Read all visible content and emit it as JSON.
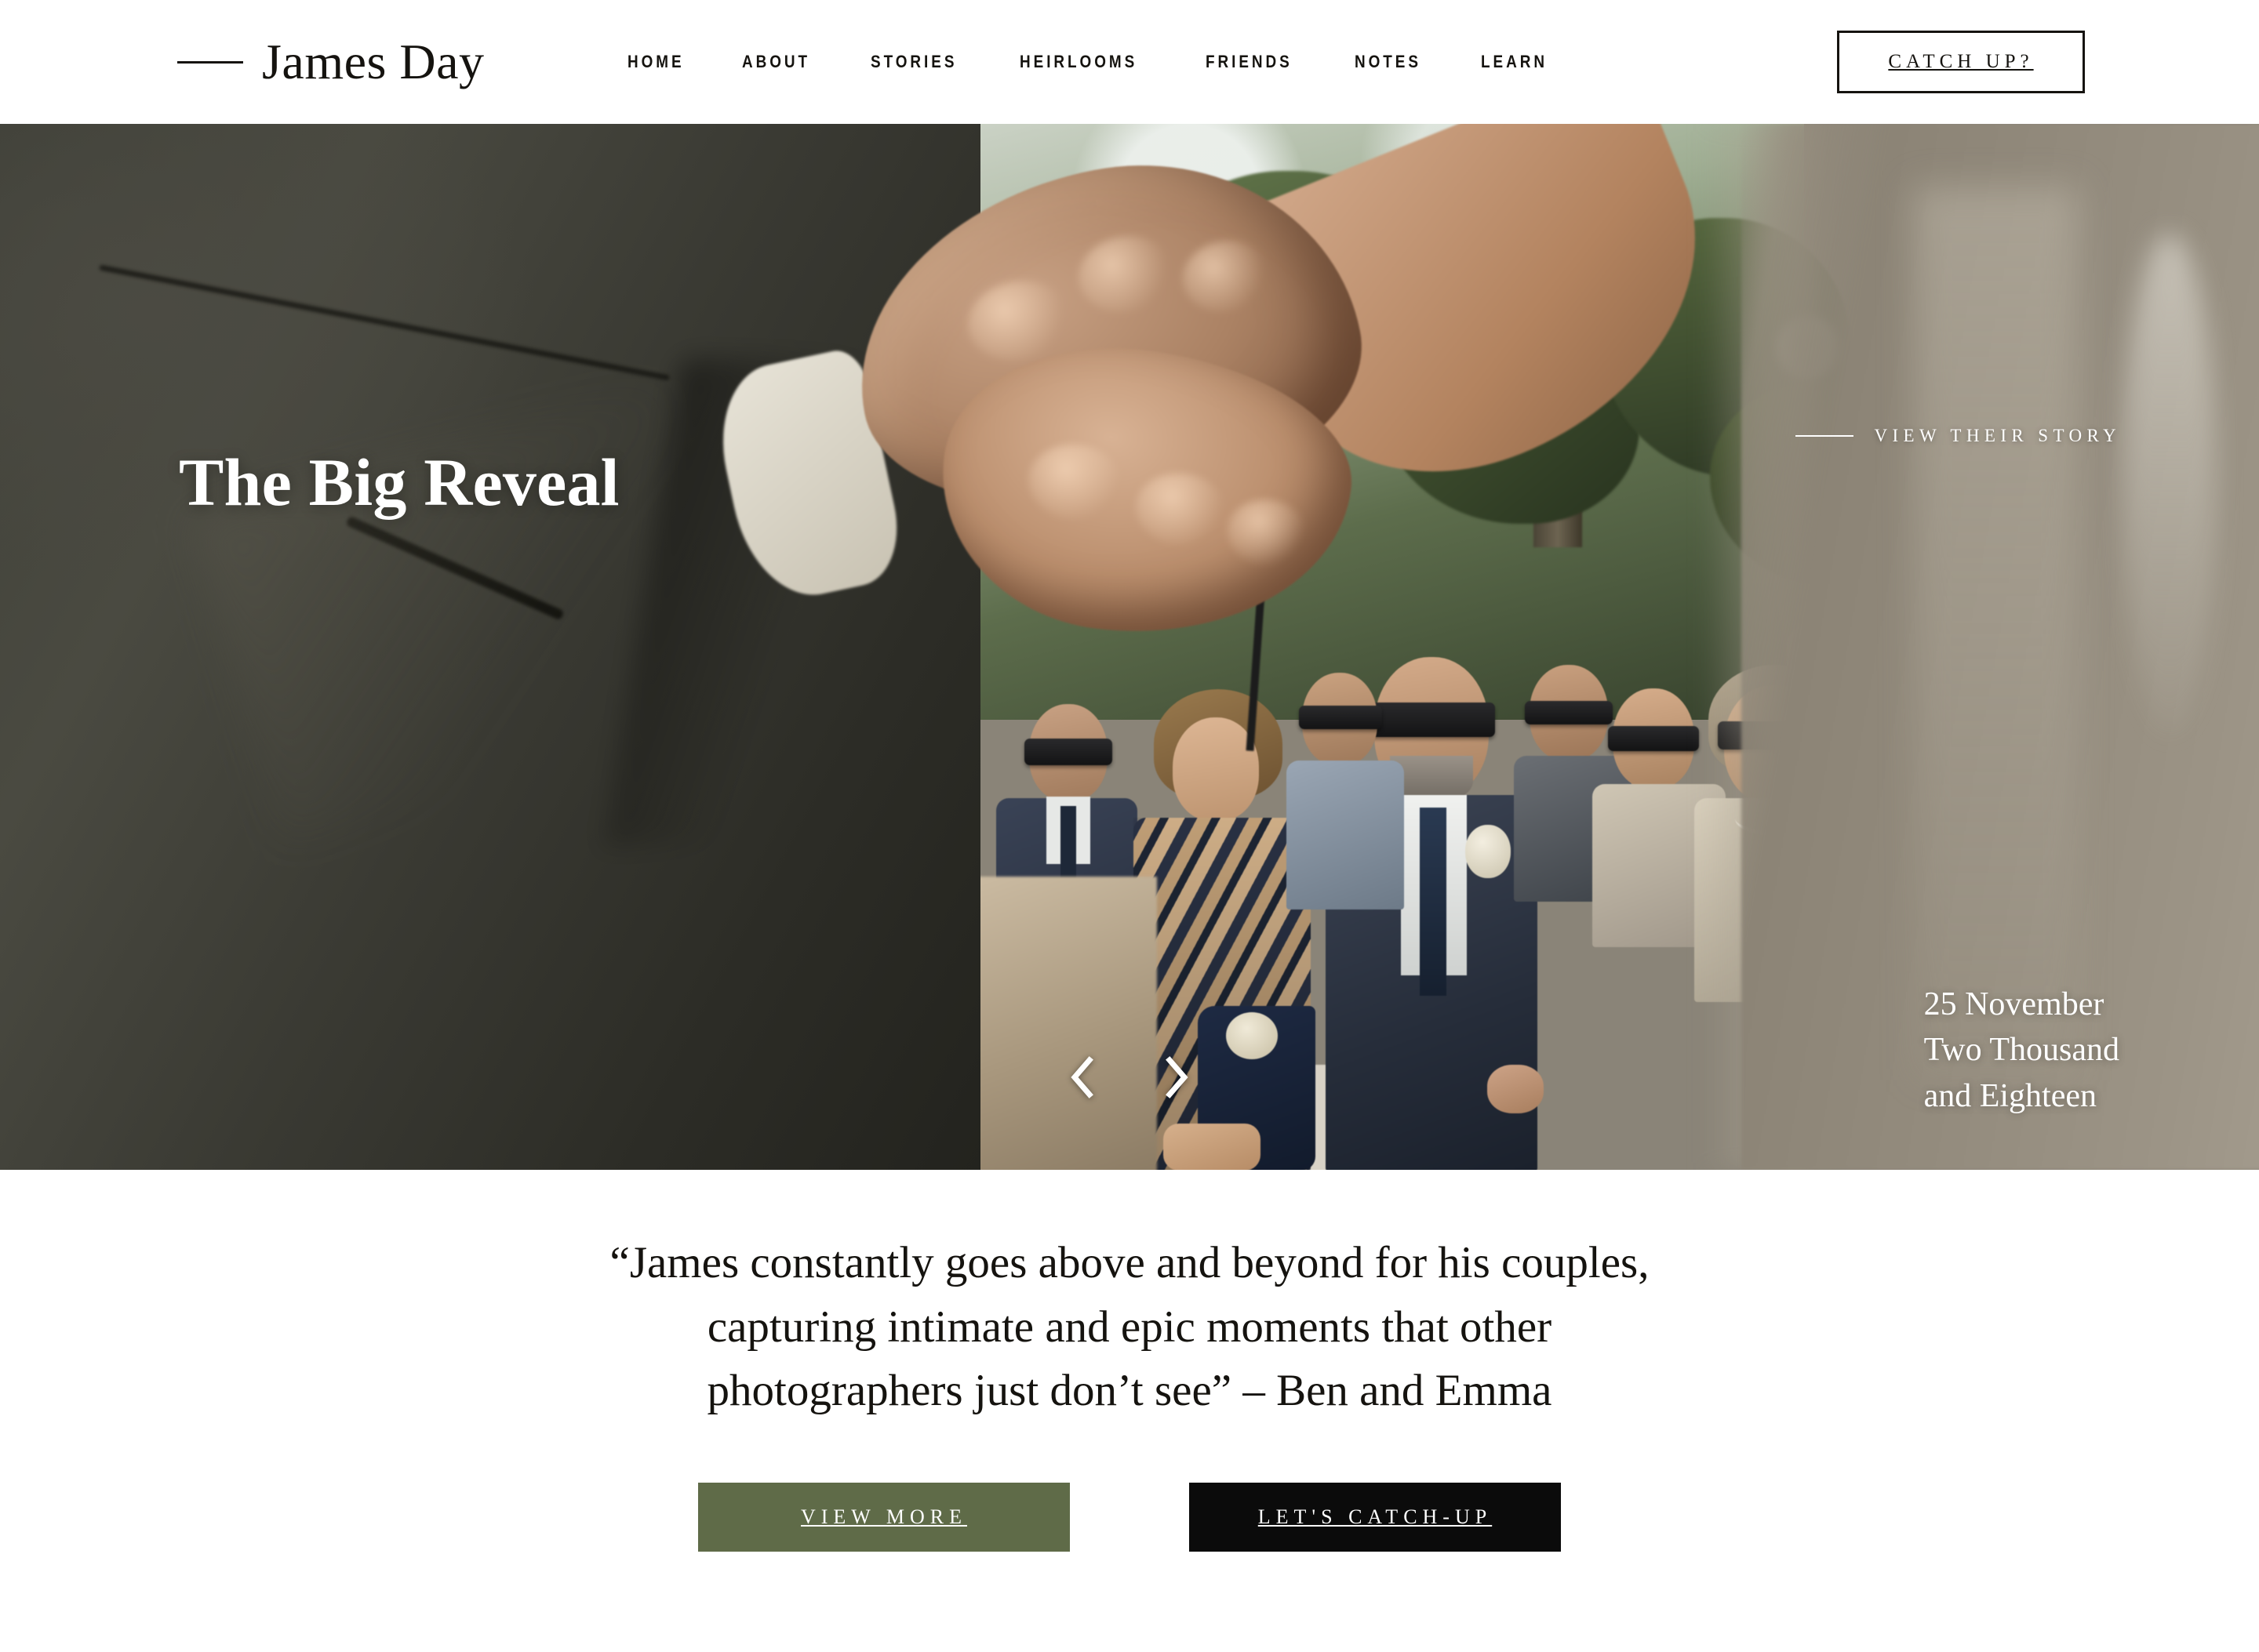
{
  "header": {
    "logo": {
      "text": "James Day",
      "rule_icon": "horizontal-rule-icon"
    },
    "nav": [
      {
        "label": "HOME"
      },
      {
        "label": "ABOUT"
      },
      {
        "label": "STORIES"
      },
      {
        "label": "HEIRLOOMS"
      },
      {
        "label": "FRIENDS"
      },
      {
        "label": "NOTES"
      },
      {
        "label": "LEARN"
      }
    ],
    "cta": {
      "label": "CATCH UP?"
    }
  },
  "hero": {
    "title": "The Big Reveal",
    "view_story": {
      "label": "VIEW THEIR STORY",
      "rule_icon": "horizontal-rule-icon"
    },
    "date": "25 November\nTwo Thousand\nand Eighteen",
    "date_lines": [
      "25 November",
      "Two Thousand",
      "and Eighteen"
    ],
    "carousel": {
      "prev_icon": "chevron-left-icon",
      "next_icon": "chevron-right-icon"
    },
    "image_alt": "Wedding ceremony — clasped hands in foreground, blindfolded guests seated"
  },
  "quote_section": {
    "quote": "“James constantly goes above and beyond for his couples, capturing intimate and epic moments that other photographers just don’t see” – Ben and Emma",
    "buttons": [
      {
        "label": "VIEW MORE",
        "color": "#5f6b48"
      },
      {
        "label": "LET'S CATCH-UP",
        "color": "#0b0b0b"
      }
    ]
  },
  "colors": {
    "ink": "#15130f",
    "olive": "#5f6b48",
    "black": "#0b0b0b",
    "white": "#ffffff"
  }
}
